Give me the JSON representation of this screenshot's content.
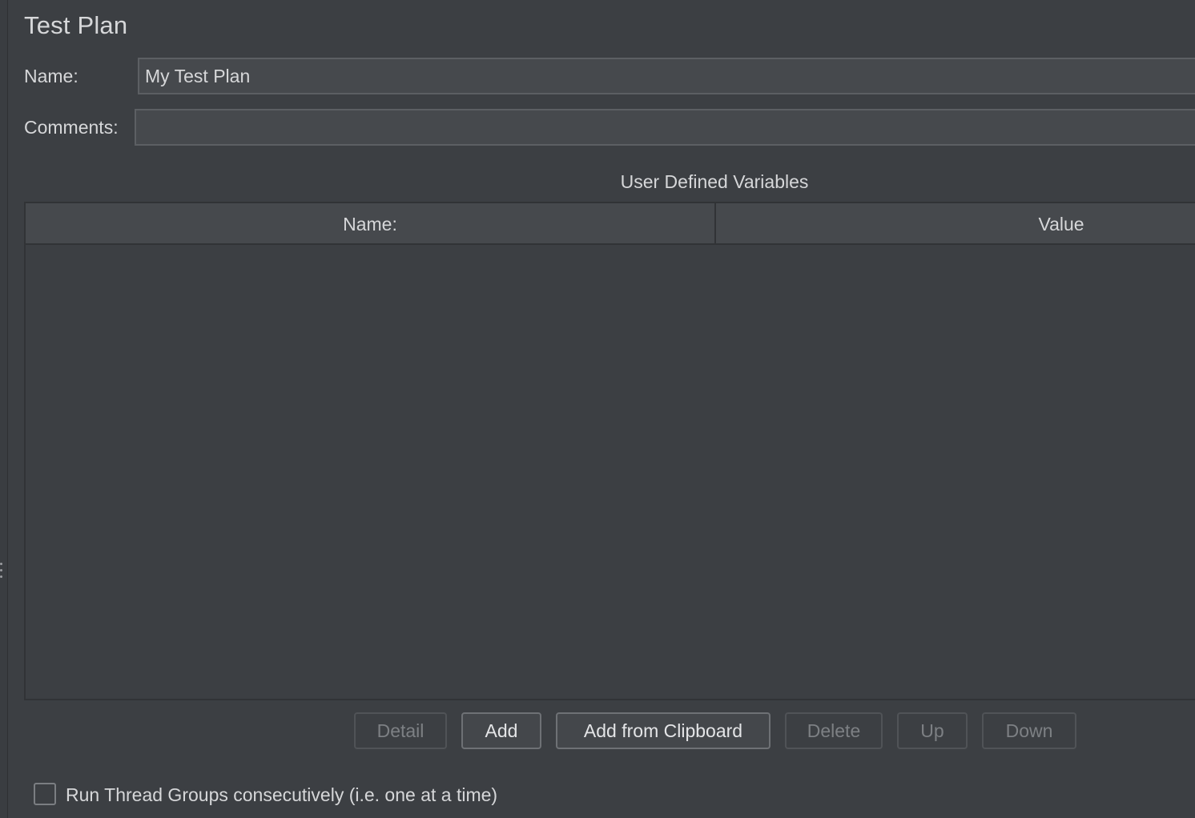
{
  "panel": {
    "title": "Test Plan"
  },
  "form": {
    "name_label": "Name:",
    "name_value": "My Test Plan",
    "comments_label": "Comments:",
    "comments_value": ""
  },
  "variables": {
    "section_title": "User Defined Variables",
    "columns": [
      "Name:",
      "Value"
    ],
    "rows": []
  },
  "buttons": [
    {
      "label": "Detail",
      "enabled": false
    },
    {
      "label": "Add",
      "enabled": true
    },
    {
      "label": "Add from Clipboard",
      "enabled": true
    },
    {
      "label": "Delete",
      "enabled": false
    },
    {
      "label": "Up",
      "enabled": false
    },
    {
      "label": "Down",
      "enabled": false
    }
  ],
  "options": {
    "run_consecutively_label": "Run Thread Groups consecutively (i.e. one at a time)",
    "run_consecutively_checked": false
  },
  "colors": {
    "background": "#3c3f43",
    "field_background": "#46494d",
    "text": "#d6d7d9",
    "disabled_text": "#7d8084"
  }
}
